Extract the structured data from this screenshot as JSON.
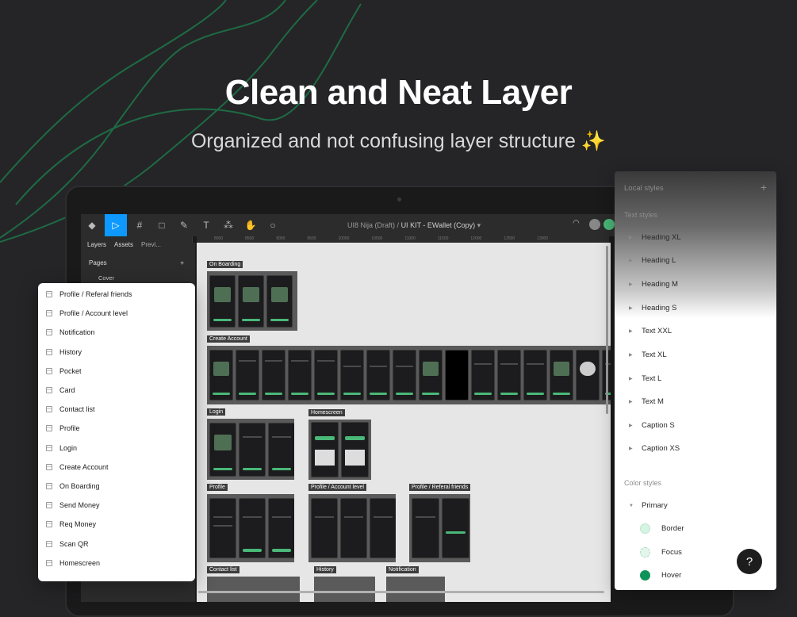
{
  "hero": {
    "title": "Clean and Neat Layer",
    "subtitle": "Organized and not confusing layer structure",
    "subtitle_emoji": "✨"
  },
  "figma": {
    "breadcrumb": {
      "project": "UI8 Nija (Draft)",
      "separator": "/",
      "file": "UI KIT - EWallet (Copy)"
    },
    "left_tabs": [
      "Layers",
      "Assets",
      "Previ..."
    ],
    "pages_header": "Pages",
    "cover_page": "Cover",
    "ruler_ticks": [
      "8000",
      "8500",
      "9000",
      "9500",
      "10000",
      "10500",
      "11000",
      "11500",
      "12000",
      "12500",
      "13000",
      "13500",
      "14000",
      "14500"
    ],
    "frames": [
      {
        "label": "On Boarding"
      },
      {
        "label": "Create Account"
      },
      {
        "label": "Login"
      },
      {
        "label": "Homescreen"
      },
      {
        "label": "Profile"
      },
      {
        "label": "Profile / Account level"
      },
      {
        "label": "Profile / Referal friends"
      },
      {
        "label": "Contact list"
      },
      {
        "label": "History"
      },
      {
        "label": "Notification"
      }
    ]
  },
  "pages_panel": {
    "items": [
      "Profile / Referal friends",
      "Profile / Account level",
      "Notification",
      "History",
      "Pocket",
      "Card",
      "Contact list",
      "Profile",
      "Login",
      "Create Account",
      "On Boarding",
      "Send Money",
      "Req Money",
      "Scan QR",
      "Homescreen"
    ]
  },
  "styles_panel": {
    "title": "Local styles",
    "add_icon": "+",
    "text_styles_label": "Text styles",
    "text_styles": [
      "Heading XL",
      "Heading L",
      "Heading M",
      "Heading S",
      "Text XXL",
      "Text XL",
      "Text L",
      "Text M",
      "Caption S",
      "Caption XS"
    ],
    "color_styles_label": "Color styles",
    "color_group": "Primary",
    "colors": [
      {
        "name": "Border",
        "hex": "#d7f3e3"
      },
      {
        "name": "Focus",
        "hex": "#e4f5ec"
      },
      {
        "name": "Hover",
        "hex": "#10935a"
      }
    ]
  },
  "help": {
    "label": "?"
  },
  "colors": {
    "accent": "#0d99ff",
    "brand_green": "#4ab878",
    "background": "#252527"
  }
}
